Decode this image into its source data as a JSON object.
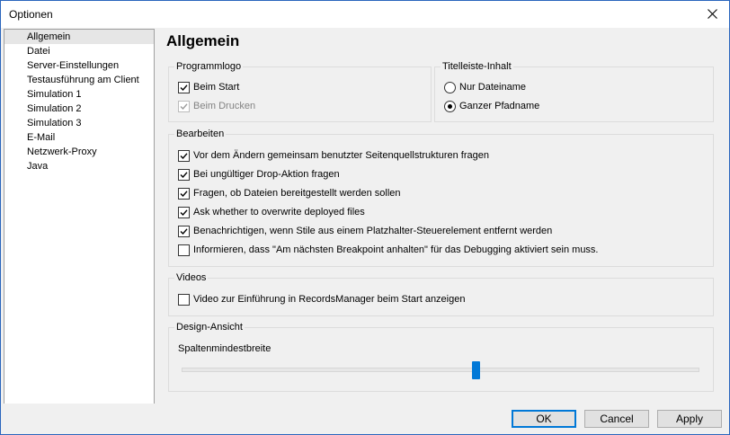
{
  "window": {
    "title": "Optionen"
  },
  "sidebar": {
    "items": [
      {
        "label": "Allgemein",
        "selected": true
      },
      {
        "label": "Datei"
      },
      {
        "label": "Server-Einstellungen"
      },
      {
        "label": "Testausführung am Client"
      },
      {
        "label": "Simulation 1"
      },
      {
        "label": "Simulation 2"
      },
      {
        "label": "Simulation 3"
      },
      {
        "label": "E-Mail"
      },
      {
        "label": "Netzwerk-Proxy"
      },
      {
        "label": "Java"
      }
    ]
  },
  "page": {
    "title": "Allgemein"
  },
  "programmlogo": {
    "label": "Programmlogo",
    "beim_start": {
      "label": "Beim Start",
      "checked": true
    },
    "beim_drucken": {
      "label": "Beim Drucken",
      "checked": true,
      "disabled": true
    }
  },
  "titelleiste": {
    "label": "Titelleiste-Inhalt",
    "nur_dateiname": {
      "label": "Nur Dateiname",
      "selected": false
    },
    "ganzer_pfadname": {
      "label": "Ganzer Pfadname",
      "selected": true
    }
  },
  "bearbeiten": {
    "label": "Bearbeiten",
    "options": [
      {
        "label": "Vor dem Ändern gemeinsam benutzter Seitenquellstrukturen fragen",
        "checked": true
      },
      {
        "label": "Bei ungültiger Drop-Aktion fragen",
        "checked": true
      },
      {
        "label": "Fragen, ob Dateien bereitgestellt werden sollen",
        "checked": true
      },
      {
        "label": "Ask whether to overwrite deployed files",
        "checked": true
      },
      {
        "label": "Benachrichtigen, wenn Stile aus einem Platzhalter-Steuerelement entfernt werden",
        "checked": true
      },
      {
        "label": "Informieren, dass \"Am nächsten Breakpoint anhalten\" für das Debugging aktiviert sein muss.",
        "checked": false
      }
    ]
  },
  "videos": {
    "label": "Videos",
    "intro_video": {
      "label": "Video zur Einführung in RecordsManager beim Start anzeigen",
      "checked": false
    }
  },
  "design": {
    "label": "Design-Ansicht",
    "slider_label": "Spaltenmindestbreite",
    "slider_value_fraction": 0.57,
    "accent_color": "#0078d7"
  },
  "footer": {
    "ok": "OK",
    "cancel": "Cancel",
    "apply": "Apply"
  },
  "icons": {
    "close": "close-icon",
    "check": "check-icon"
  }
}
